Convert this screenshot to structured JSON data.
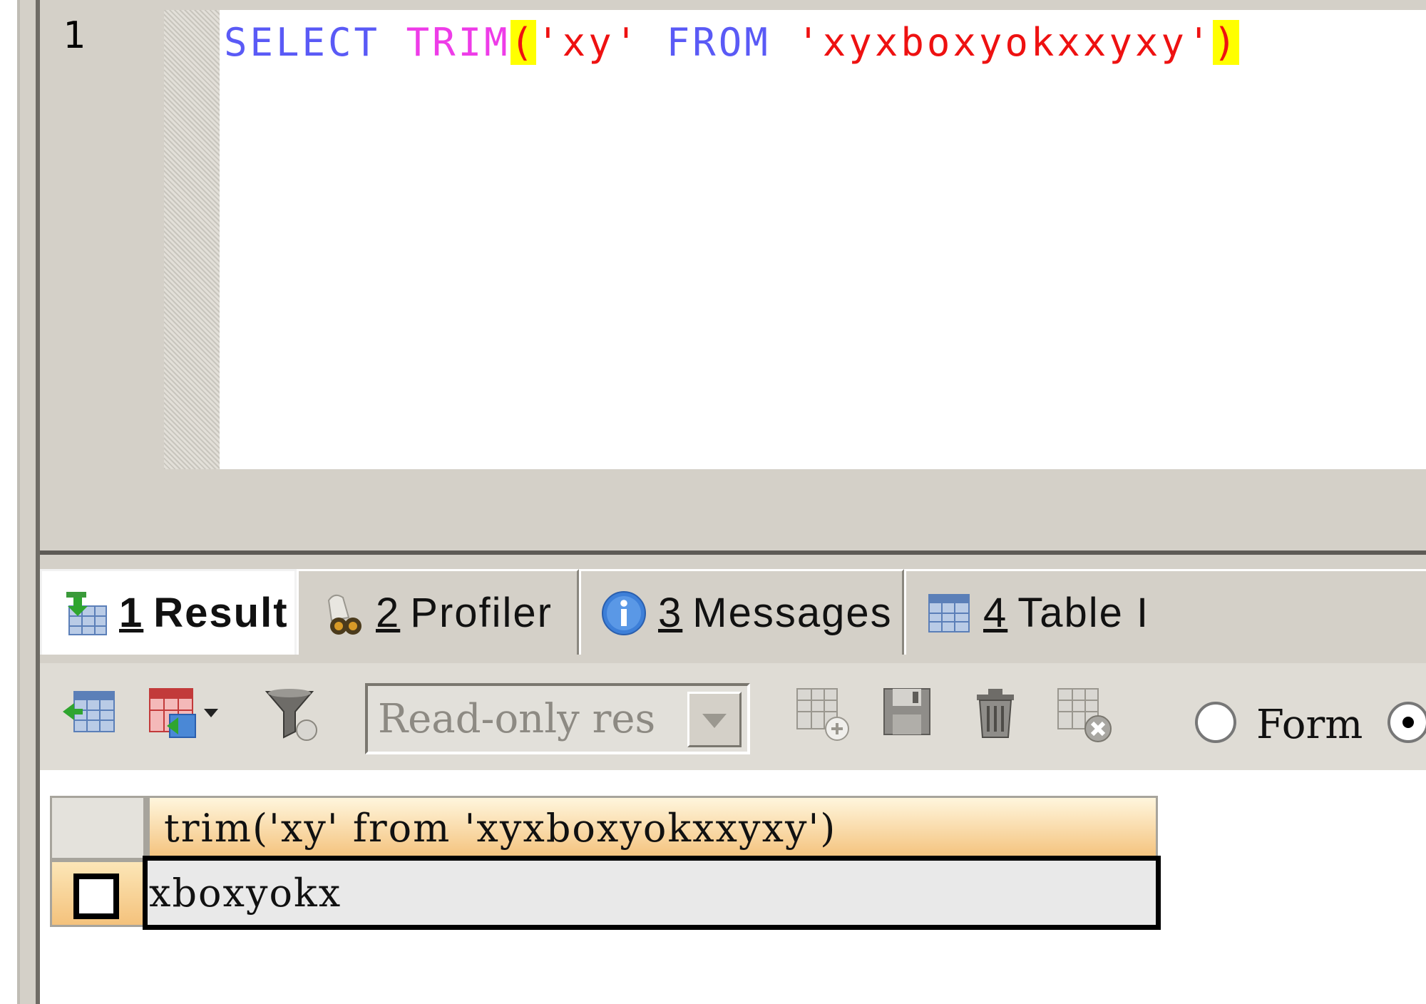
{
  "editor": {
    "line_number": "1",
    "code_tokens": {
      "select": "SELECT",
      "trim": "TRIM",
      "open_paren": "(",
      "arg1": "'xy'",
      "from": "FROM",
      "arg2": "'xyxboxyokxxyxy'",
      "close_paren": ")"
    }
  },
  "tabs": [
    {
      "num": "1",
      "label": "Result",
      "icon": "result-grid-icon",
      "active": true
    },
    {
      "num": "2",
      "label": "Profiler",
      "icon": "profiler-binoculars-icon",
      "active": false
    },
    {
      "num": "3",
      "label": "Messages",
      "icon": "info-icon",
      "active": false
    },
    {
      "num": "4",
      "label": "Table I",
      "icon": "table-icon",
      "active": false
    }
  ],
  "toolbar": {
    "result_mode_value": "Read-only res",
    "form_label": "Form"
  },
  "grid": {
    "column_header": "trim('xy' from 'xyxboxyokxxyxy')",
    "rows": [
      {
        "value": "xboxyokx"
      }
    ]
  },
  "colors": {
    "keyword_blue": "#5a5af6",
    "function_magenta": "#ee3ce8",
    "string_red": "#ee1111",
    "bracket_highlight": "#ffff00"
  }
}
